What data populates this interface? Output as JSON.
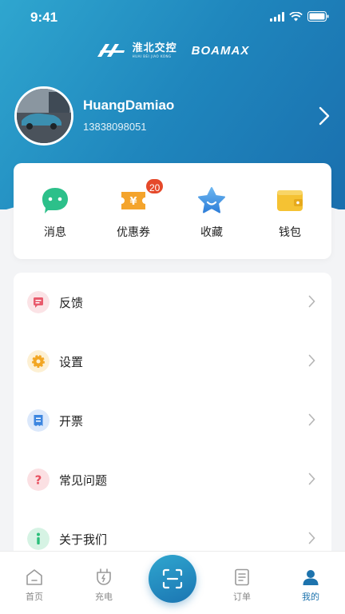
{
  "status_bar": {
    "time": "9:41"
  },
  "brands": {
    "brand1_cn": "淮北交控",
    "brand1_en": "HUAI BEI JIAO KONG",
    "brand2": "BOAMAX"
  },
  "profile": {
    "name": "HuangDamiao",
    "phone": "13838098051"
  },
  "quick_actions": [
    {
      "label": "消息",
      "icon": "chat-bubble-icon",
      "color": "#2cc08a"
    },
    {
      "label": "优惠券",
      "icon": "coupon-icon",
      "color": "#f4a42c",
      "badge": "20"
    },
    {
      "label": "收藏",
      "icon": "star-icon",
      "color": "#3e8fe0"
    },
    {
      "label": "钱包",
      "icon": "wallet-icon",
      "color": "#f5c233"
    }
  ],
  "menu": [
    {
      "label": "反馈",
      "icon": "feedback-icon",
      "color": "#e85a6c"
    },
    {
      "label": "设置",
      "icon": "settings-icon",
      "color": "#f2a623"
    },
    {
      "label": "开票",
      "icon": "invoice-icon",
      "color": "#3d86e0"
    },
    {
      "label": "常见问题",
      "icon": "question-icon",
      "color": "#e8505f"
    },
    {
      "label": "关于我们",
      "icon": "info-icon",
      "color": "#2bbf7a"
    }
  ],
  "tabs": [
    {
      "label": "首页",
      "icon": "home-icon"
    },
    {
      "label": "充电",
      "icon": "charge-plug-icon"
    },
    {
      "label": "",
      "icon": "scan-icon"
    },
    {
      "label": "订单",
      "icon": "order-list-icon"
    },
    {
      "label": "我的",
      "icon": "user-icon",
      "active": true
    }
  ],
  "colors": {
    "primary": "#1d73ad",
    "badge": "#e5492a"
  }
}
